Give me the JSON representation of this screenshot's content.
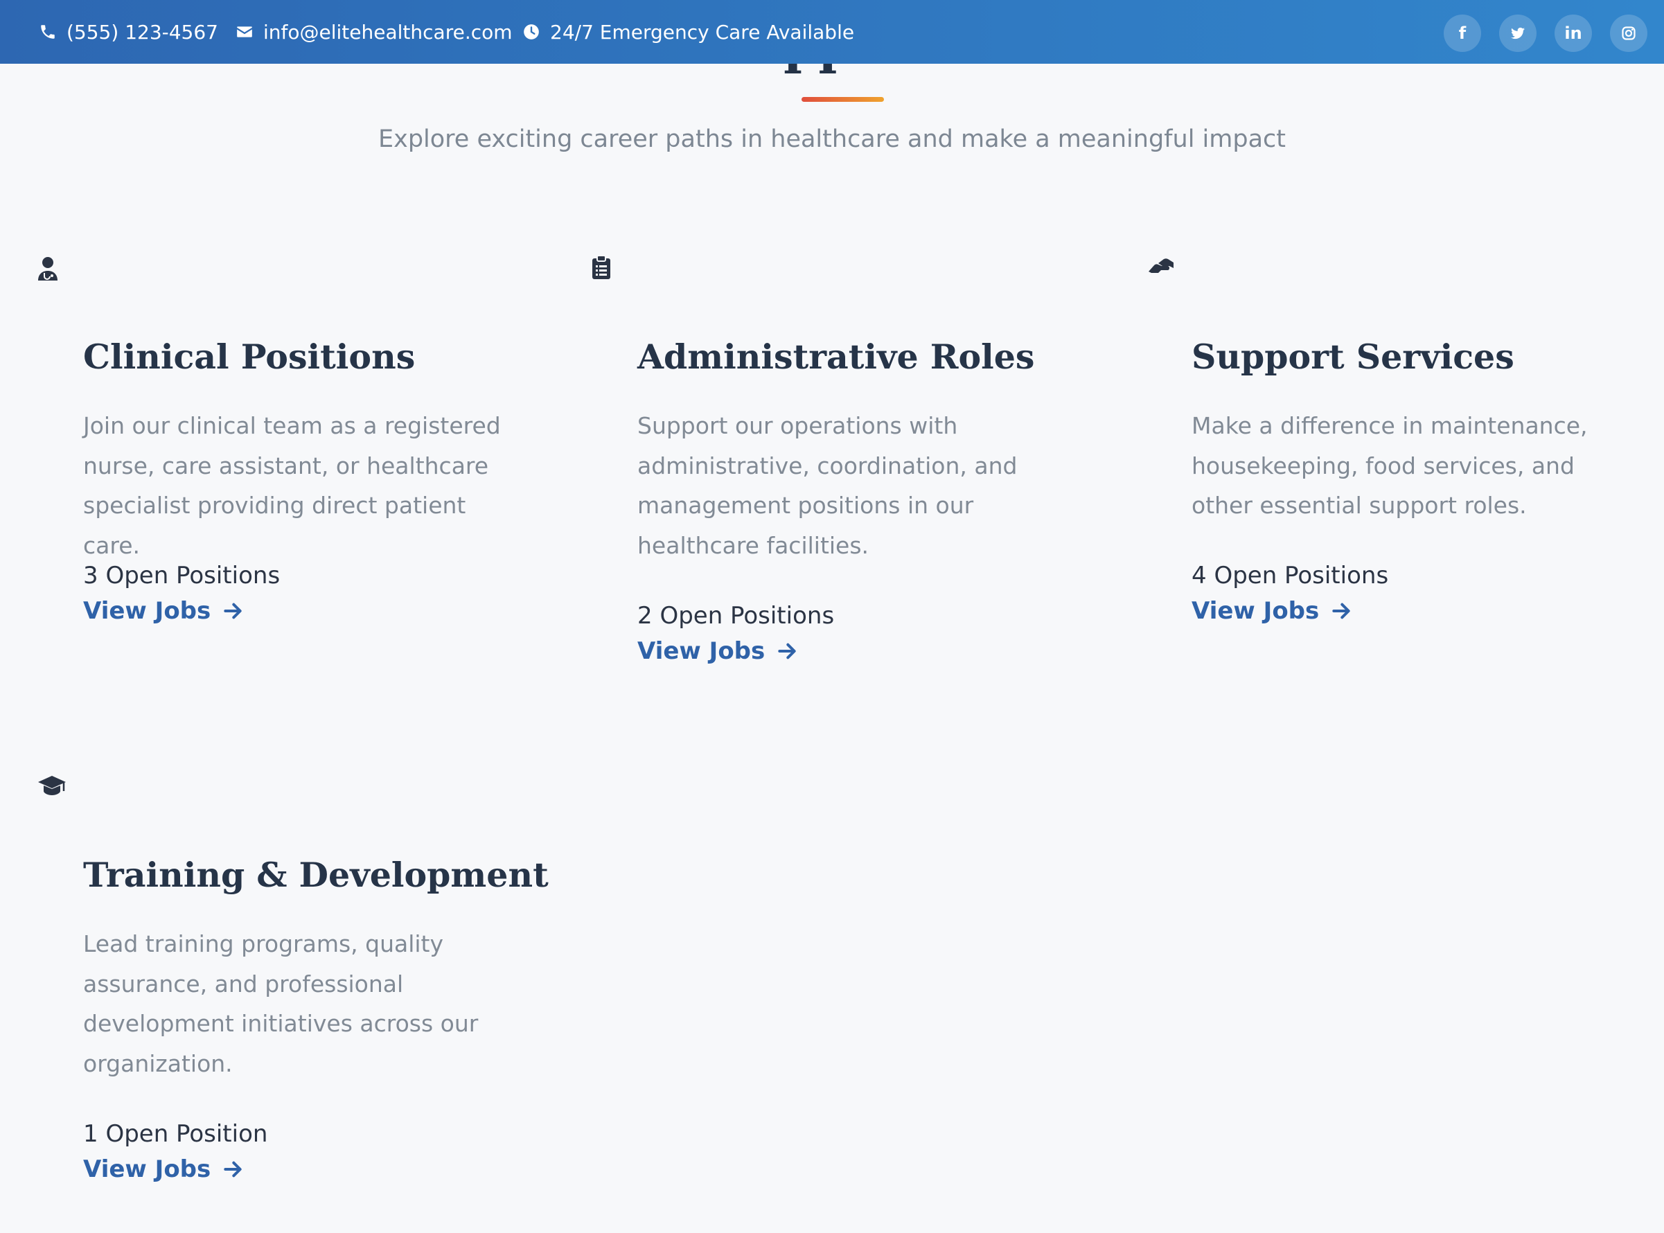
{
  "topbar": {
    "phone": "(555) 123-4567",
    "email": "info@elitehealthcare.com",
    "hours": "24/7 Emergency Care Available",
    "icons": {
      "phone": "phone-icon",
      "email": "envelope-icon",
      "hours": "clock-icon"
    },
    "social": [
      {
        "name": "facebook-icon",
        "glyph": "f"
      },
      {
        "name": "twitter-icon",
        "glyph": ""
      },
      {
        "name": "linkedin-icon",
        "glyph": "in"
      },
      {
        "name": "instagram-icon",
        "glyph": ""
      }
    ]
  },
  "section": {
    "title": "Career Opportunities",
    "subtitle": "Explore exciting career paths in healthcare and make a meaningful impact"
  },
  "cards": [
    {
      "icon": "user-doctor-icon",
      "title": "Clinical Positions",
      "description": "Join our clinical team as a registered nurse, care assistant, or healthcare specialist providing direct patient care.",
      "openings": "3 Open Positions",
      "link": "View Jobs"
    },
    {
      "icon": "clipboard-list-icon",
      "title": "Administrative Roles",
      "description": "Support our operations with administrative, coordination, and management positions in our healthcare facilities.",
      "openings": "2 Open Positions",
      "link": "View Jobs"
    },
    {
      "icon": "hands-helping-icon",
      "title": "Support Services",
      "description": "Make a difference in maintenance, housekeeping, food services, and other essential support roles.",
      "openings": "4 Open Positions",
      "link": "View Jobs"
    },
    {
      "icon": "graduation-cap-icon",
      "title": "Training & Development",
      "description": "Lead training programs, quality assurance, and professional development initiatives across our organization.",
      "openings": "1 Open Position",
      "link": "View Jobs"
    }
  ],
  "colors": {
    "topbar_start": "#2d67b2",
    "topbar_end": "#3286cc",
    "heading": "#263448",
    "muted_text": "#818a95",
    "link": "#2f62a8",
    "accent_start": "#e04e3c",
    "accent_end": "#efa22e",
    "background": "#f7f8fa"
  }
}
